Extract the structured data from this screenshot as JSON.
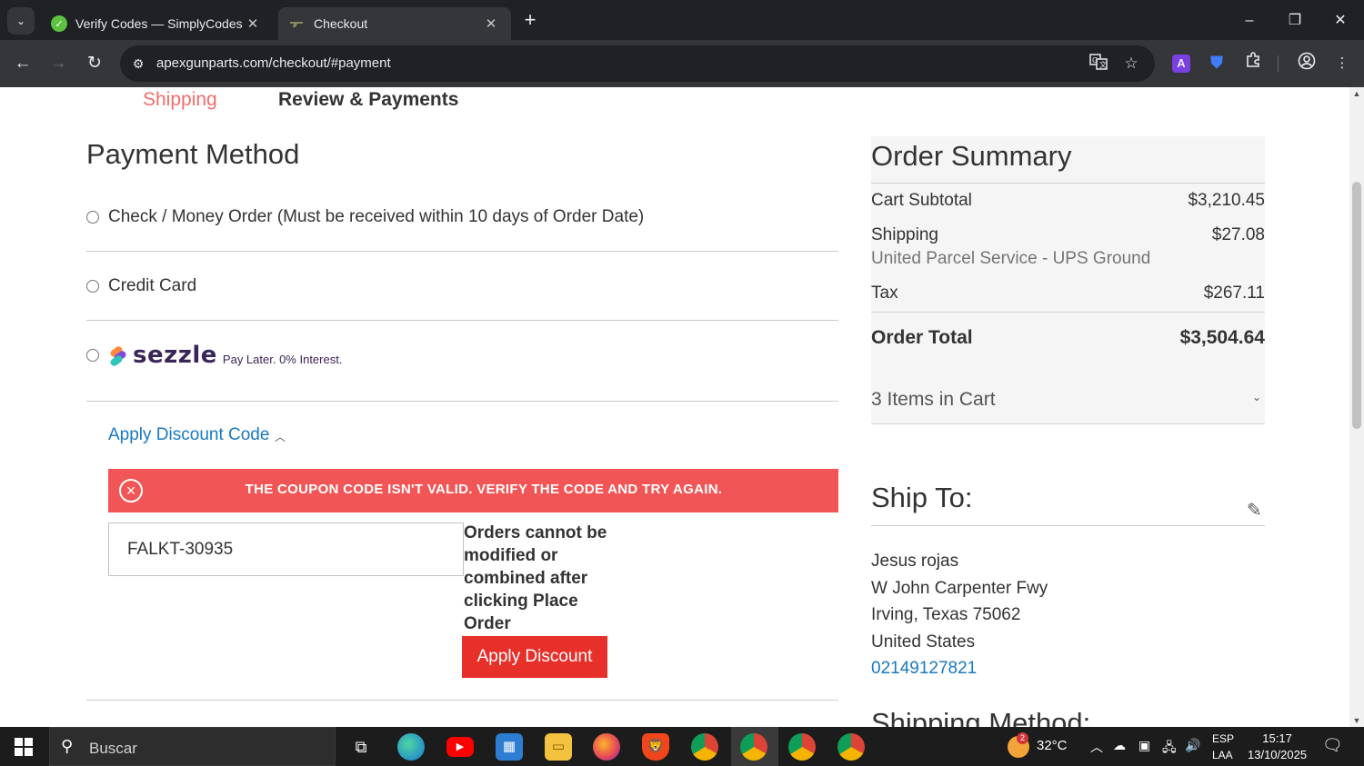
{
  "browser": {
    "tabs": [
      {
        "title": "Verify Codes — SimplyCodes",
        "active": false
      },
      {
        "title": "Checkout",
        "active": true
      }
    ],
    "new_tab": "+",
    "url": "apexgunparts.com/checkout/#payment",
    "window": {
      "minimize": "–",
      "restore": "❐",
      "close": "✕"
    }
  },
  "checkout": {
    "steps": {
      "shipping": "Shipping",
      "review": "Review & Payments"
    },
    "payment_method": {
      "title": "Payment Method",
      "options": [
        {
          "label": "Check / Money Order (Must be received within 10 days of Order Date)"
        },
        {
          "label": "Credit Card"
        },
        {
          "label": "sezzle",
          "tagline": "Pay Later. 0% Interest."
        }
      ]
    },
    "discount": {
      "toggle_label": "Apply Discount Code",
      "error": "THE COUPON CODE ISN'T VALID. VERIFY THE CODE AND TRY AGAIN.",
      "code_value": "FALKT-30935",
      "note": "Orders cannot be modified or combined after clicking Place Order",
      "button_label": "Apply Discount"
    }
  },
  "summary": {
    "title": "Order Summary",
    "cart_subtotal": {
      "label": "Cart Subtotal",
      "value": "$3,210.45"
    },
    "shipping": {
      "label": "Shipping",
      "value": "$27.08",
      "method": "United Parcel Service - UPS Ground"
    },
    "tax": {
      "label": "Tax",
      "value": "$267.11"
    },
    "order_total": {
      "label": "Order Total",
      "value": "$3,504.64"
    },
    "items_in_cart": "3 Items in Cart"
  },
  "ship_to": {
    "title": "Ship To:",
    "name": "Jesus rojas",
    "street": "W John Carpenter Fwy",
    "city": "Irving, Texas 75062",
    "country": "United States",
    "phone": "02149127821"
  },
  "shipping_method_title": "Shipping Method:",
  "taskbar": {
    "search_placeholder": "Buscar",
    "weather_temp": "32°C",
    "weather_badge": "2",
    "lang_top": "ESP",
    "lang_bottom": "LAA",
    "time": "15:17",
    "date": "13/10/2025"
  },
  "colors": {
    "accent_red": "#e8302a",
    "error_bg": "#f25555",
    "link_blue": "#1979c3",
    "step_pink": "#f36c6c"
  }
}
